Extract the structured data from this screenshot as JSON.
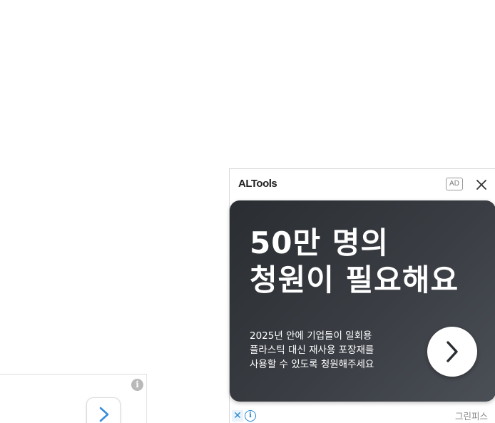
{
  "background_ad": {
    "info_icon": "info-icon",
    "next_icon": "chevron-right-icon"
  },
  "ad_popup": {
    "brand": "ALTools",
    "badge": "AD",
    "close_icon": "close-icon",
    "headline": [
      "50만 명의",
      "청원이 필요해요"
    ],
    "body": [
      "2025년 안에 기업들이 일회용",
      "플라스틱 대신 재사용 포장재를",
      "사용할 수 있도록 청원해주세요"
    ],
    "cta_icon": "chevron-right-icon",
    "ad_choices": {
      "close_glyph": "✕",
      "info_glyph": "i"
    },
    "advertiser": "그린피스"
  },
  "colors": {
    "card_bg": "#2f3338",
    "accent_blue": "#2a88d0",
    "chevron_blue": "#3a8dde"
  }
}
